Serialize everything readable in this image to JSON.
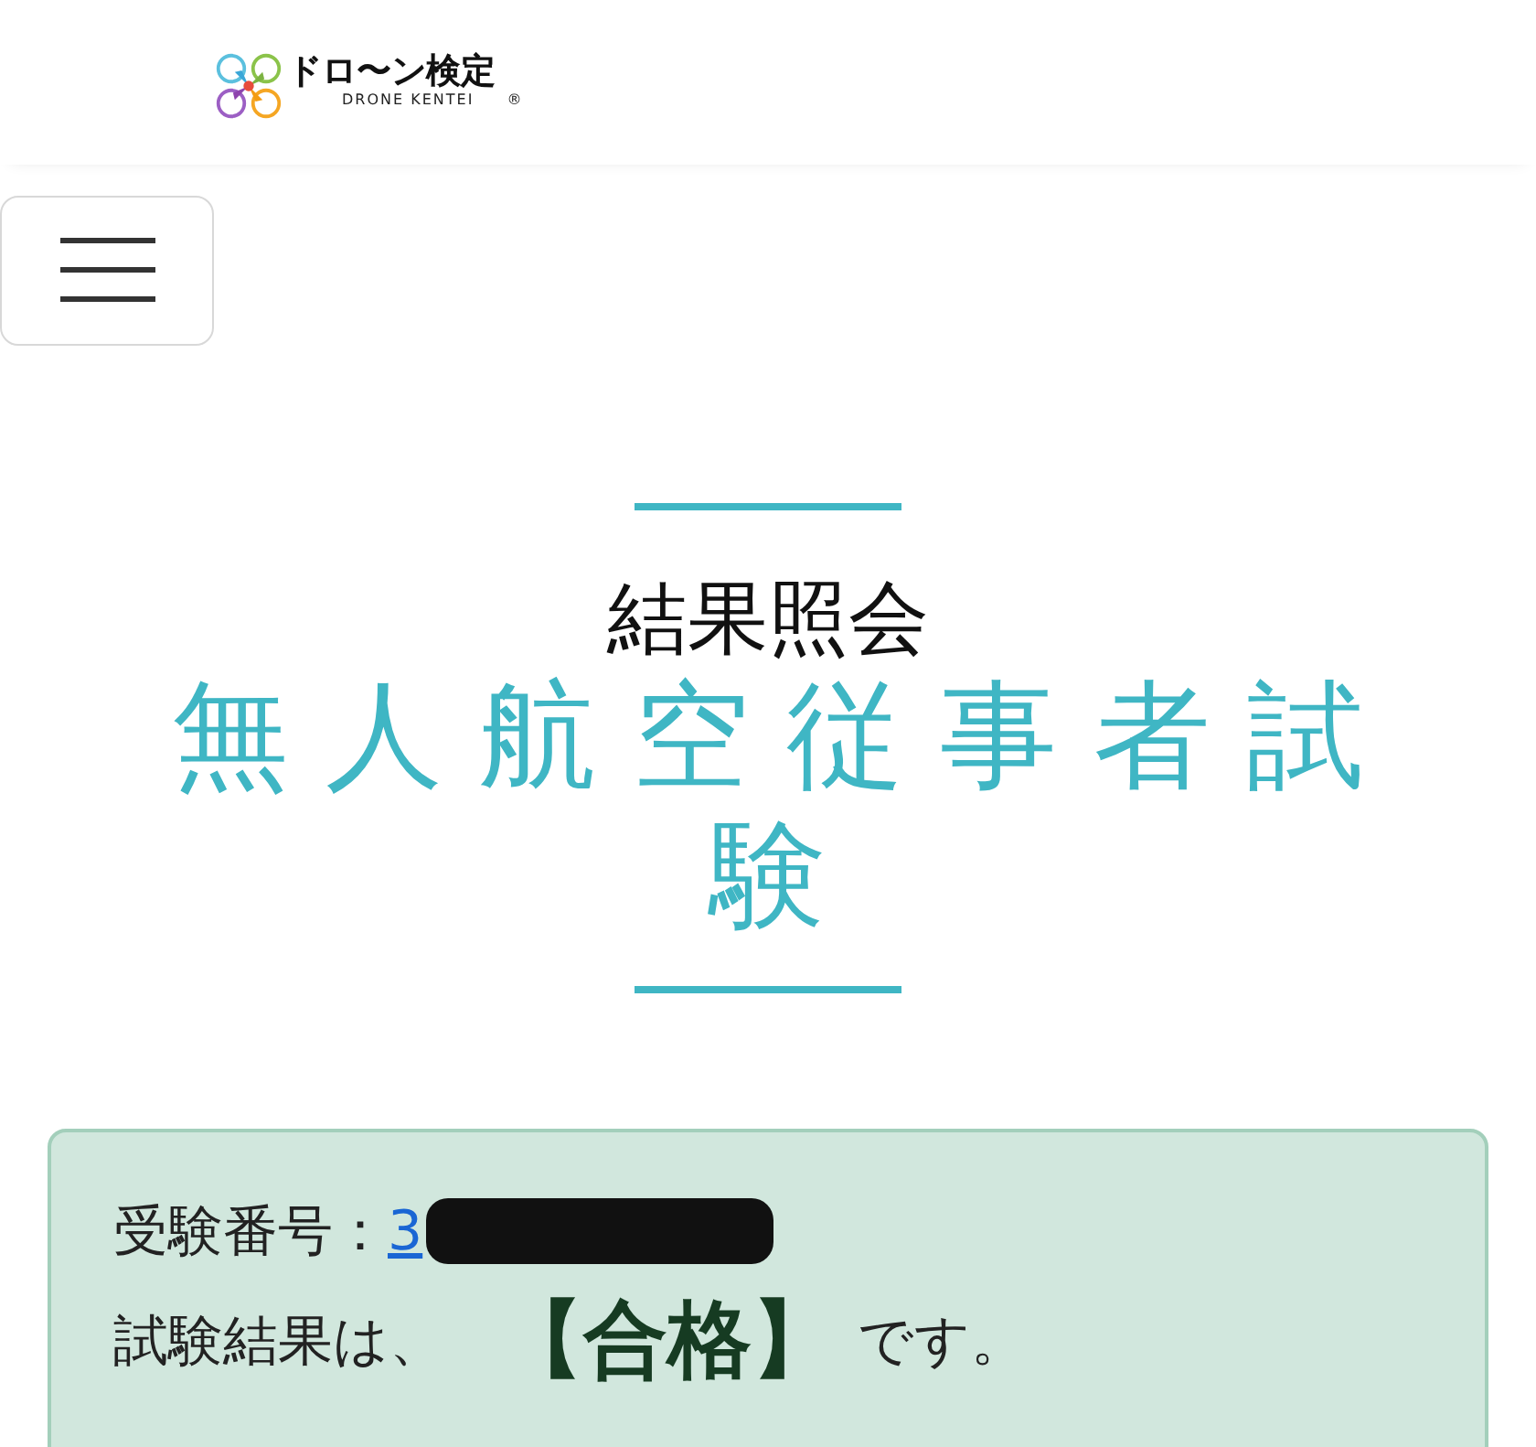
{
  "header": {
    "logo": {
      "title": "ドロ〜ン検定",
      "subtitle": "DRONE KENTEI",
      "mark": "®"
    }
  },
  "heading": {
    "subtitle": "結果照会",
    "title": "無人航空従事者試験"
  },
  "result": {
    "number_label": "受験番号：",
    "number_visible": "3",
    "number_redacted": true,
    "result_prefix": "試験結果は、",
    "result": "【合格】",
    "result_suffix": "です。"
  }
}
